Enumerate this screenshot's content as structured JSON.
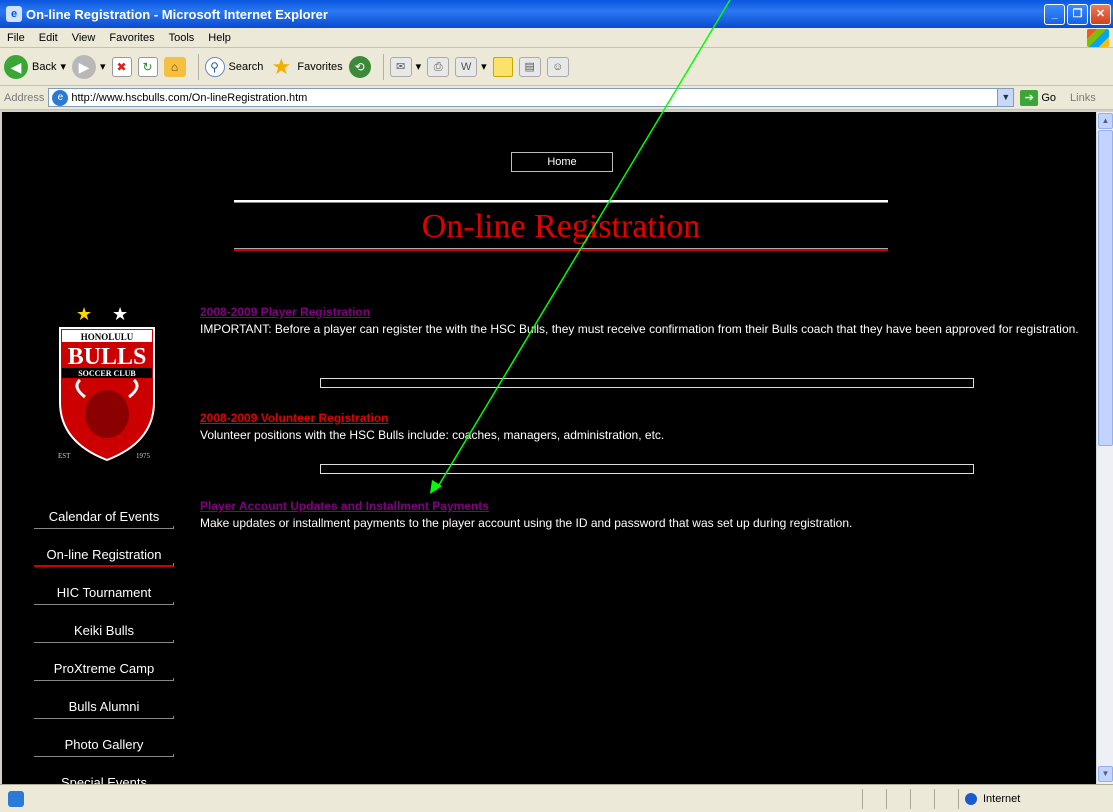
{
  "window": {
    "title": "On-line Registration - Microsoft Internet Explorer"
  },
  "menu": [
    "File",
    "Edit",
    "View",
    "Favorites",
    "Tools",
    "Help"
  ],
  "toolbar": {
    "back": "Back",
    "search": "Search",
    "favorites": "Favorites"
  },
  "address": {
    "label": "Address",
    "url": "http://www.hscbulls.com/On-lineRegistration.htm",
    "go": "Go",
    "links": "Links"
  },
  "page": {
    "home": "Home",
    "title": "On-line Registration",
    "logo": {
      "top": "HONOLULU",
      "main": "BULLS",
      "sub": "SOCCER CLUB",
      "est": "EST",
      "year": "1975"
    },
    "sections": [
      {
        "link": "2008-2009 Player Registration",
        "text": "IMPORTANT:  Before a player can register the with the HSC Bulls, they must receive confirmation from their Bulls coach that they have been approved for registration."
      },
      {
        "link": "2008-2009 Volunteer Registration",
        "text": "Volunteer positions with the HSC Bulls include:  coaches, managers, administration, etc."
      },
      {
        "link": "Player Account Updates and Installment Payments",
        "text": "Make updates or installment payments to the player account using the ID and password that was set up during registration."
      }
    ],
    "nav": [
      "Calendar of Events",
      "On-line Registration",
      "HIC Tournament",
      "Keiki Bulls",
      "ProXtreme Camp",
      "Bulls Alumni",
      "Photo Gallery",
      "Special Events"
    ]
  },
  "status": {
    "zone": "Internet"
  }
}
